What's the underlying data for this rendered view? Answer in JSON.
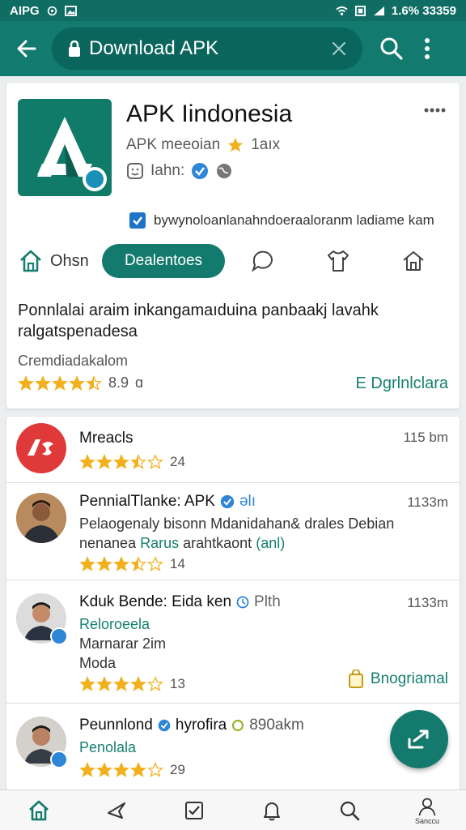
{
  "status_bar": {
    "left_text": "AIPG",
    "right_text": "1.6% 33359"
  },
  "search": {
    "query": "Download APK"
  },
  "app": {
    "title": "APK Iindonesia",
    "subtitle": "APK meeoian",
    "rating_short": "1aıx",
    "label": "Iahn:",
    "checkbox_text": "bywynoloanlanahndoeraaloranm ladiame kam",
    "tabs": [
      {
        "label": "Ohsn"
      },
      {
        "label": "Dealentoes"
      }
    ],
    "description": "Ponnlalai araim inkangamaıduina panbaakj lavahk ralgatspenadesa",
    "section_label": "Cremdiadakalom",
    "rating_value": "8.9",
    "rating_extra": "ɑ",
    "download_link": "E Dgrlnlclara",
    "rating_stars": 4.5
  },
  "list": [
    {
      "title": "Mreacls",
      "time": "115 bm",
      "rating": "24",
      "stars": 3.5
    },
    {
      "title": "PennialTlanke: APK",
      "title_suffix": "əlı",
      "time": "1133m",
      "line1": "Pelaogenaly bisonn Mdanidahan& drales Debian",
      "line2": "nenanea",
      "line2_b": "Rarus",
      "line2_c": "arahtkaont",
      "line2_d": "(anl)",
      "rating": "14",
      "stars": 3.5
    },
    {
      "title": "Kduk Bende: Eida ken",
      "title_suffix": "Plth",
      "time": "1133m",
      "line1": "Reloroeela",
      "line2": "Marnarar 2im",
      "line3": "Moda",
      "rating": "13",
      "stars": 4,
      "action": "Bnogriamal"
    },
    {
      "title": "Peunnlond",
      "title_suffix": "hyrofira",
      "title_extra": "890akm",
      "line1": "Penolala",
      "rating": "29",
      "stars": 4
    }
  ],
  "nav": {
    "profile_label": "Sanccu"
  },
  "colors": {
    "primary": "#127a6f",
    "primary_dark": "#0f6d64",
    "star": "#f2b01e",
    "verified": "#2f86d6",
    "link": "#158070"
  }
}
